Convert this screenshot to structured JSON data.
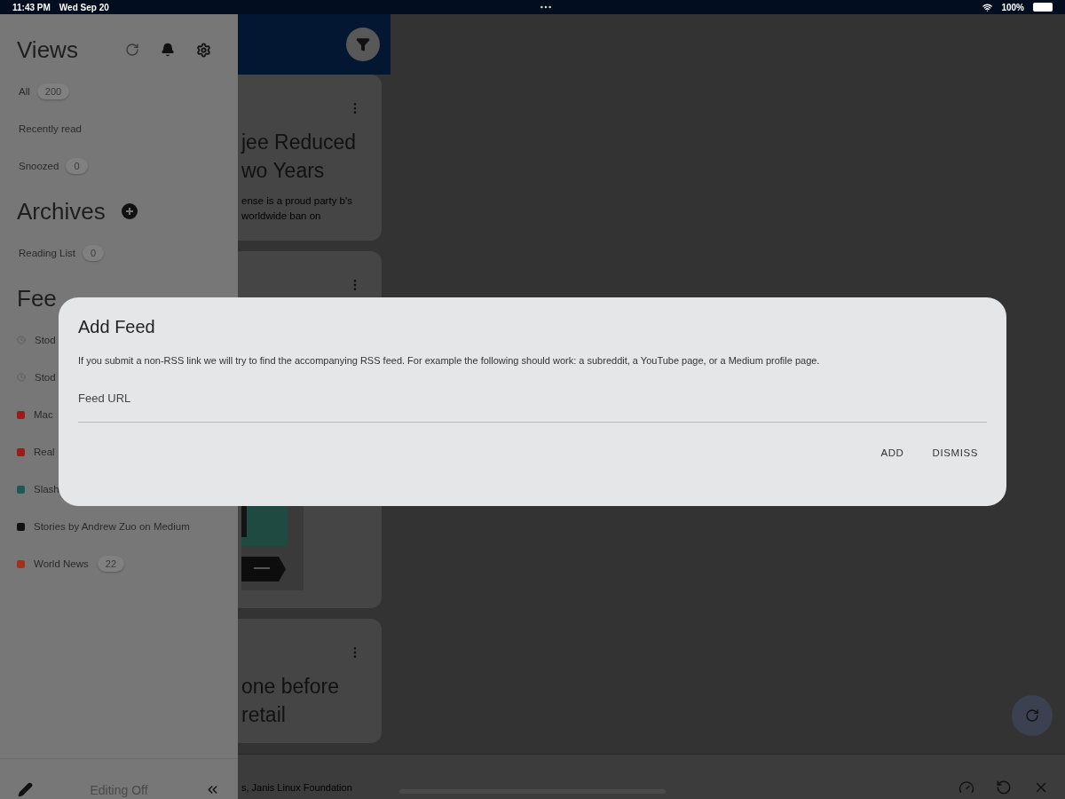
{
  "status_bar": {
    "time": "11:43 PM",
    "date": "Wed Sep 20",
    "battery": "100%"
  },
  "drawer": {
    "views": {
      "title": "Views",
      "items": [
        {
          "label": "All",
          "count": "200"
        },
        {
          "label": "Recently read"
        },
        {
          "label": "Snoozed",
          "count": "0"
        }
      ]
    },
    "archives": {
      "title": "Archives",
      "items": [
        {
          "label": "Reading List",
          "count": "0"
        }
      ]
    },
    "feeds": {
      "title": "Fee",
      "items": [
        {
          "label": "Stod",
          "kind": "clock",
          "color": "#5a5a5a"
        },
        {
          "label": "Stod",
          "kind": "clock",
          "color": "#5a5a5a"
        },
        {
          "label": "Mac",
          "kind": "logo",
          "color": "#9c1a1a"
        },
        {
          "label": "Real",
          "kind": "logo",
          "color": "#9c1a1a"
        },
        {
          "label": "Slash",
          "kind": "logo",
          "color": "#1d5a55"
        },
        {
          "label": "Stories by Andrew Zuo on Medium",
          "kind": "logo",
          "color": "#111111"
        },
        {
          "label": "World News",
          "kind": "logo",
          "color": "#a3321c",
          "count": "22"
        }
      ]
    },
    "footer": {
      "status": "Editing Off"
    }
  },
  "cards": [
    {
      "title": "jee Reduced wo Years",
      "snippet": "ense is a proud party b's worldwide ban on"
    },
    {
      "kind": "picture"
    },
    {
      "title": "one before retail"
    }
  ],
  "player": {
    "text": "s, Janis Linux Foundation"
  },
  "dialog": {
    "title": "Add Feed",
    "description": "If you submit a non-RSS link we will try to find the accompanying RSS feed. For example the following should work: a subreddit, a YouTube page, or a Medium profile page.",
    "field": {
      "placeholder": "Feed URL"
    },
    "buttons": [
      "ADD",
      "DISMISS"
    ]
  }
}
